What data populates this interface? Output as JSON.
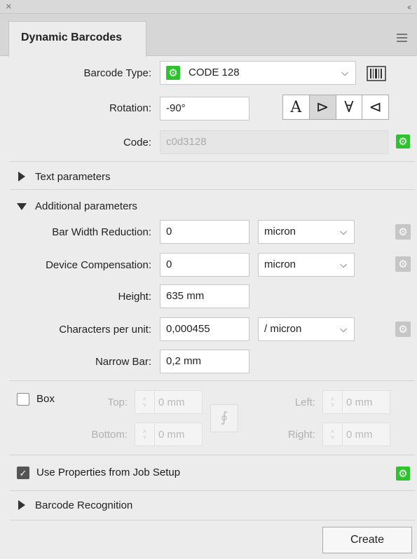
{
  "panel": {
    "tab_title": "Dynamic Barcodes",
    "close_glyph": "×",
    "collapse_glyph": "‹‹",
    "menu_icon": "hamburger-icon"
  },
  "barcode": {
    "type_label": "Barcode Type:",
    "type_value": "CODE 128",
    "rotation_label": "Rotation:",
    "rotation_value": "-90°",
    "rotation_options": [
      "A",
      "⊳",
      "∀",
      "⊲"
    ],
    "rotation_active_index": 1,
    "code_label": "Code:",
    "code_value": "c0d3128"
  },
  "sections": {
    "text_parameters": "Text parameters",
    "additional_parameters": "Additional parameters",
    "barcode_recognition": "Barcode Recognition"
  },
  "additional": {
    "bar_width_label": "Bar Width Reduction:",
    "bar_width_value": "0",
    "bar_width_unit": "micron",
    "device_comp_label": "Device Compensation:",
    "device_comp_value": "0",
    "device_comp_unit": "micron",
    "height_label": "Height:",
    "height_value": "635 mm",
    "cpu_label": "Characters per unit:",
    "cpu_value": "0,000455",
    "cpu_unit": "/ micron",
    "narrow_bar_label": "Narrow Bar:",
    "narrow_bar_value": "0,2 mm"
  },
  "box": {
    "label": "Box",
    "checked": false,
    "top_label": "Top:",
    "top_value": "0 mm",
    "bottom_label": "Bottom:",
    "bottom_value": "0 mm",
    "left_label": "Left:",
    "left_value": "0 mm",
    "right_label": "Right:",
    "right_value": "0 mm"
  },
  "job_setup": {
    "label": "Use Properties from Job Setup",
    "checked": true
  },
  "actions": {
    "create_label": "Create"
  },
  "colors": {
    "accent_green": "#2ec32e",
    "panel_bg": "#ececec"
  }
}
